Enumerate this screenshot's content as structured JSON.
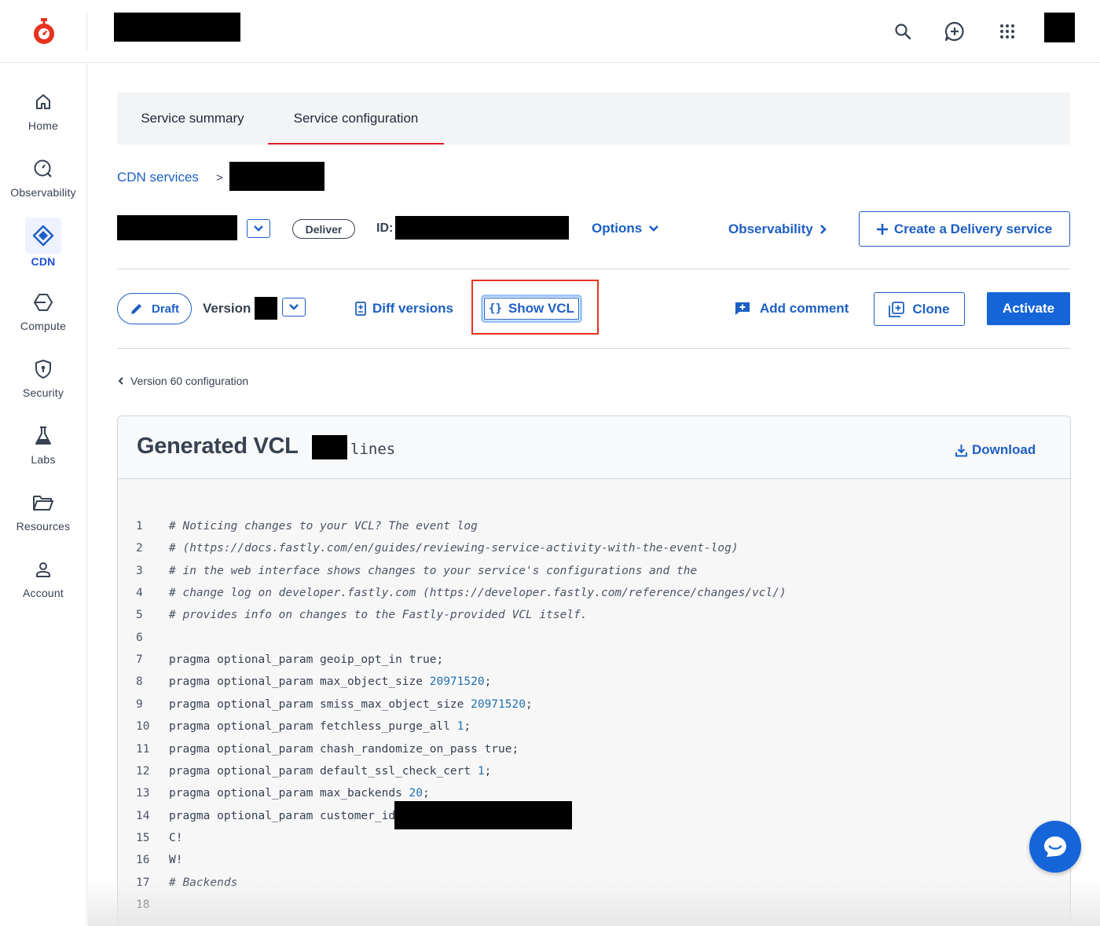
{
  "sidebar": {
    "items": [
      {
        "label": "Home",
        "icon": "home-icon"
      },
      {
        "label": "Observability",
        "icon": "observability-icon"
      },
      {
        "label": "CDN",
        "icon": "cdn-icon",
        "active": true
      },
      {
        "label": "Compute",
        "icon": "compute-icon"
      },
      {
        "label": "Security",
        "icon": "security-icon"
      },
      {
        "label": "Labs",
        "icon": "labs-icon"
      },
      {
        "label": "Resources",
        "icon": "resources-icon"
      },
      {
        "label": "Account",
        "icon": "account-icon"
      }
    ]
  },
  "tabs": [
    {
      "label": "Service summary"
    },
    {
      "label": "Service configuration",
      "active": true
    }
  ],
  "breadcrumb": {
    "link": "CDN services",
    "separator": ">"
  },
  "service": {
    "type_badge": "Deliver",
    "id_label": "ID:",
    "options_label": "Options",
    "observability_label": "Observability",
    "create_label": "Create a Delivery service"
  },
  "version_bar": {
    "draft_label": "Draft",
    "version_label": "Version",
    "diff_label": "Diff versions",
    "show_vcl_label": "Show VCL",
    "add_comment_label": "Add comment",
    "clone_label": "Clone",
    "activate_label": "Activate"
  },
  "back_link": "Version 60 configuration",
  "vcl": {
    "title": "Generated VCL",
    "lines_suffix": "lines",
    "download_label": "Download",
    "code": [
      {
        "n": "1",
        "text": "# Noticing changes to your VCL? The event log",
        "comment": true
      },
      {
        "n": "2",
        "text": "# (https://docs.fastly.com/en/guides/reviewing-service-activity-with-the-event-log)",
        "comment": true
      },
      {
        "n": "3",
        "text": "# in the web interface shows changes to your service's configurations and the",
        "comment": true
      },
      {
        "n": "4",
        "text": "# change log on developer.fastly.com (https://developer.fastly.com/reference/changes/vcl/)",
        "comment": true
      },
      {
        "n": "5",
        "text": "# provides info on changes to the Fastly-provided VCL itself.",
        "comment": true
      },
      {
        "n": "6",
        "text": ""
      },
      {
        "n": "7",
        "text": "pragma optional_param geoip_opt_in true;"
      },
      {
        "n": "8",
        "text": "pragma optional_param max_object_size ",
        "value": "20971520",
        "tail": ";"
      },
      {
        "n": "9",
        "text": "pragma optional_param smiss_max_object_size ",
        "value": "20971520",
        "tail": ";"
      },
      {
        "n": "10",
        "text": "pragma optional_param fetchless_purge_all ",
        "value": "1",
        "tail": ";"
      },
      {
        "n": "11",
        "text": "pragma optional_param chash_randomize_on_pass true;"
      },
      {
        "n": "12",
        "text": "pragma optional_param default_ssl_check_cert ",
        "value": "1",
        "tail": ";"
      },
      {
        "n": "13",
        "text": "pragma optional_param max_backends ",
        "value": "20",
        "tail": ";"
      },
      {
        "n": "14",
        "text": "pragma optional_param customer_id",
        "redacted": true
      },
      {
        "n": "15",
        "text": "C!"
      },
      {
        "n": "16",
        "text": "W!"
      },
      {
        "n": "17",
        "text": "# Backends",
        "comment": true
      },
      {
        "n": "18",
        "text": ""
      }
    ]
  },
  "colors": {
    "brand_red": "#e8321f",
    "link_blue": "#1d5fc4",
    "primary_blue": "#1565d8",
    "tab_underline": "#e11d2a"
  }
}
